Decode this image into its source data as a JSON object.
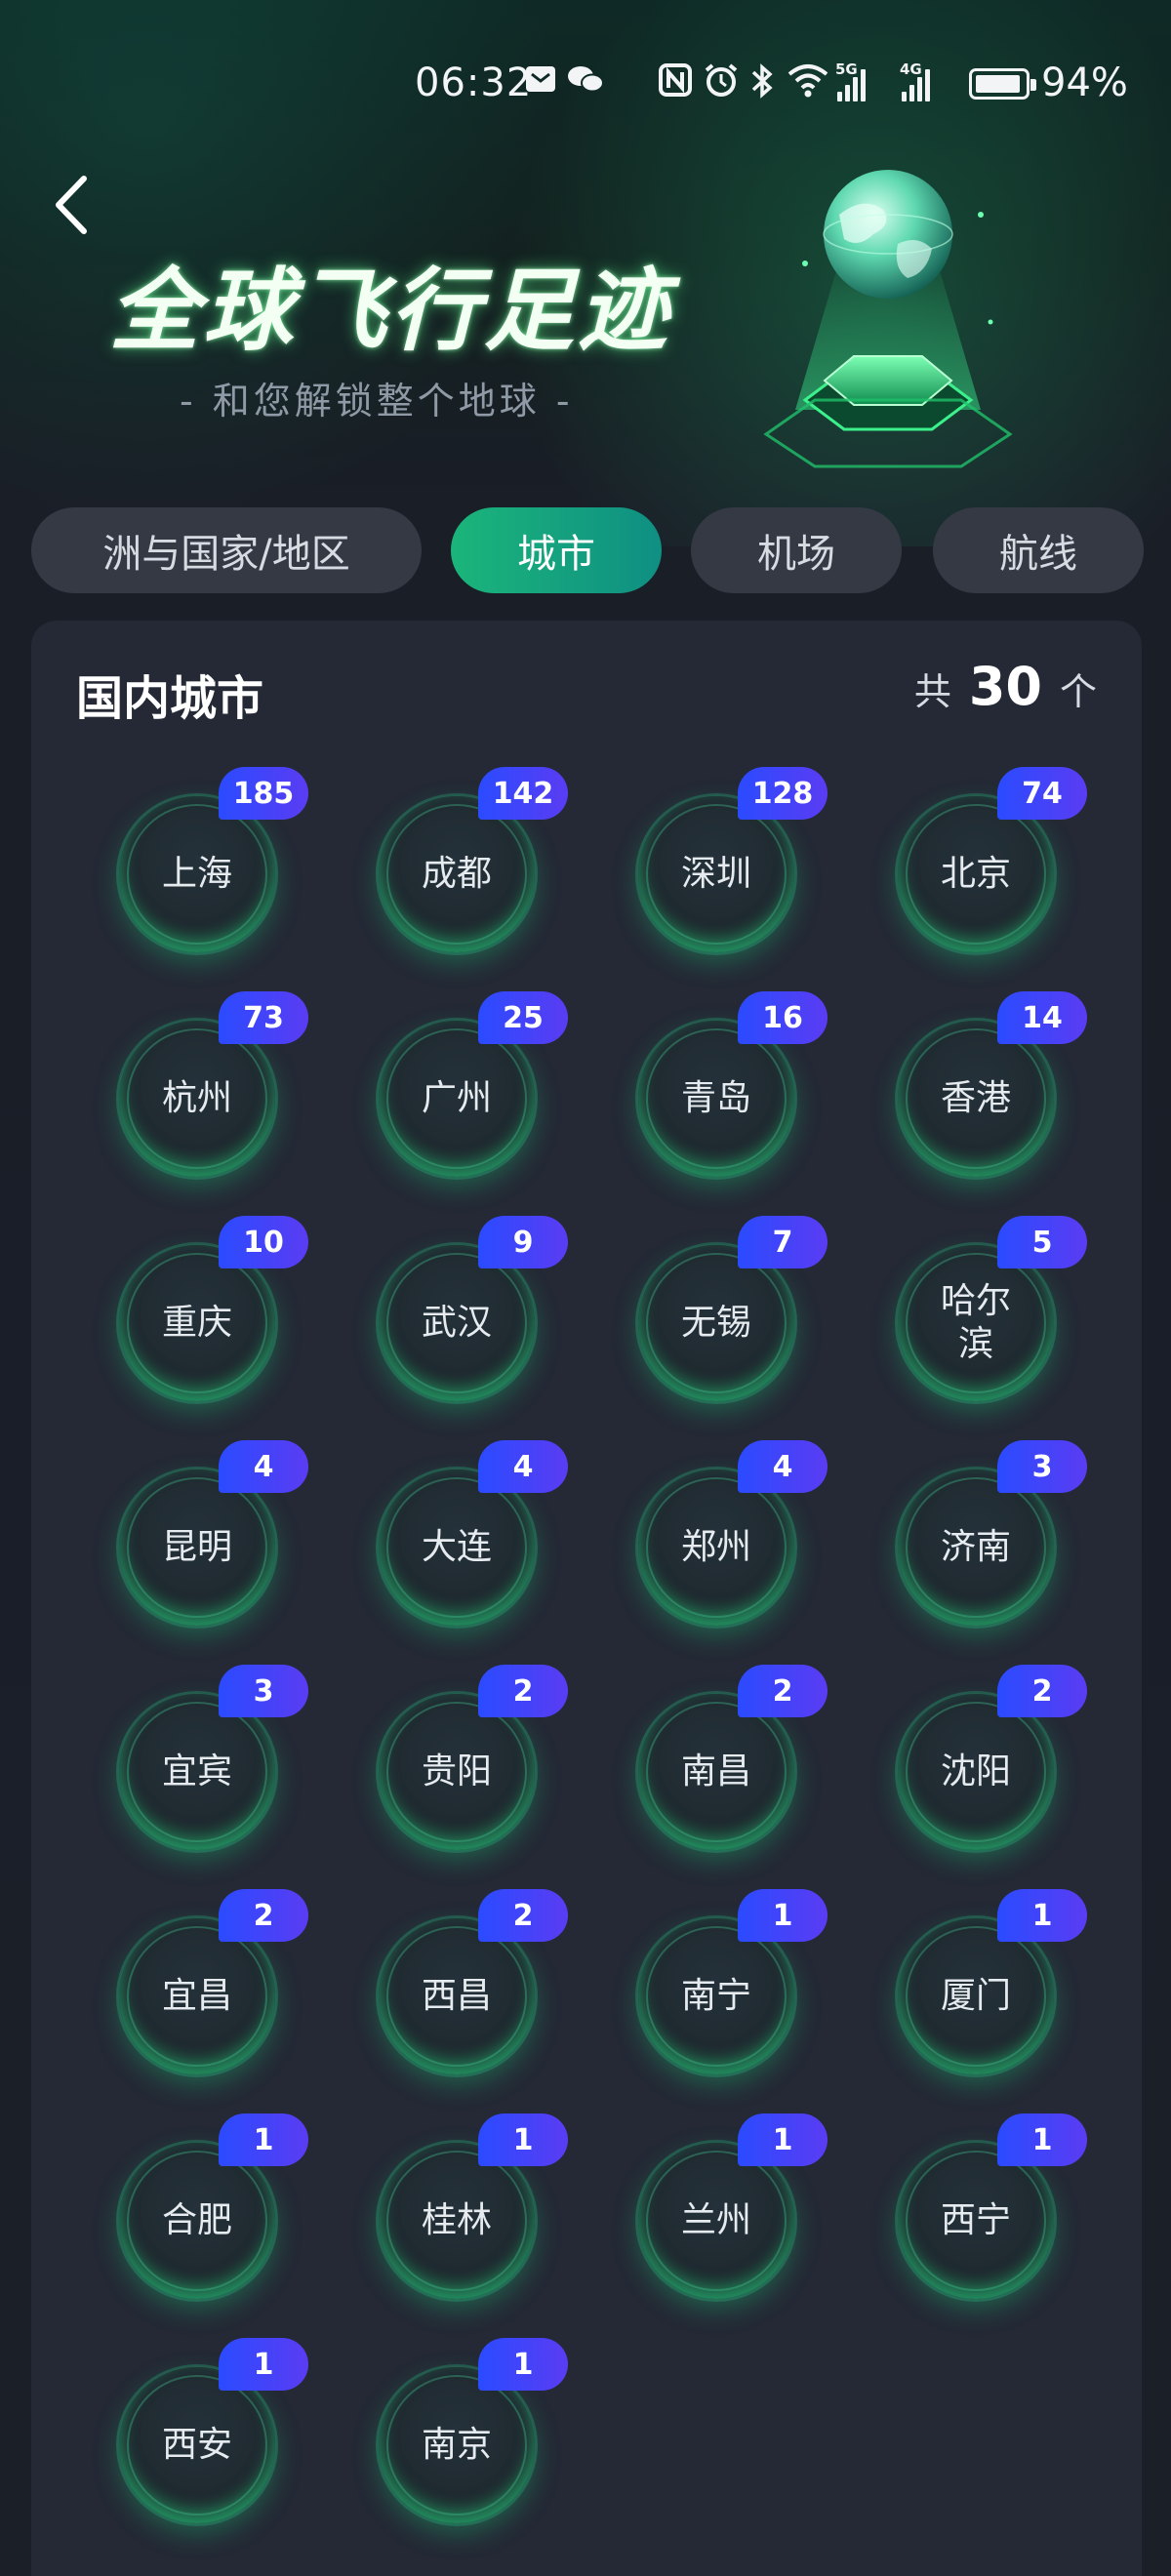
{
  "status_bar": {
    "time": "06:32",
    "battery_percent": "94%",
    "signal_labels": [
      "5G",
      "4G"
    ],
    "icons": [
      "mail-icon",
      "wechat-icon",
      "nfc-icon",
      "alarm-icon",
      "bluetooth-icon",
      "wifi-icon",
      "signal-5g-icon",
      "signal-4g-icon",
      "battery-icon"
    ]
  },
  "header": {
    "title": "全球飞行足迹",
    "subtitle": "- 和您解锁整个地球 -"
  },
  "tabs": [
    {
      "label": "洲与国家/地区",
      "active": false
    },
    {
      "label": "城市",
      "active": true
    },
    {
      "label": "机场",
      "active": false
    },
    {
      "label": "航线",
      "active": false
    }
  ],
  "card": {
    "title": "国内城市",
    "count_prefix": "共",
    "count": "30",
    "count_suffix": "个"
  },
  "cities": [
    {
      "name": "上海",
      "count": "185"
    },
    {
      "name": "成都",
      "count": "142"
    },
    {
      "name": "深圳",
      "count": "128"
    },
    {
      "name": "北京",
      "count": "74"
    },
    {
      "name": "杭州",
      "count": "73"
    },
    {
      "name": "广州",
      "count": "25"
    },
    {
      "name": "青岛",
      "count": "16"
    },
    {
      "name": "香港",
      "count": "14"
    },
    {
      "name": "重庆",
      "count": "10"
    },
    {
      "name": "武汉",
      "count": "9"
    },
    {
      "name": "无锡",
      "count": "7"
    },
    {
      "name": "哈尔滨",
      "count": "5"
    },
    {
      "name": "昆明",
      "count": "4"
    },
    {
      "name": "大连",
      "count": "4"
    },
    {
      "name": "郑州",
      "count": "4"
    },
    {
      "name": "济南",
      "count": "3"
    },
    {
      "name": "宜宾",
      "count": "3"
    },
    {
      "name": "贵阳",
      "count": "2"
    },
    {
      "name": "南昌",
      "count": "2"
    },
    {
      "name": "沈阳",
      "count": "2"
    },
    {
      "name": "宜昌",
      "count": "2"
    },
    {
      "name": "西昌",
      "count": "2"
    },
    {
      "name": "南宁",
      "count": "1"
    },
    {
      "name": "厦门",
      "count": "1"
    },
    {
      "name": "合肥",
      "count": "1"
    },
    {
      "name": "桂林",
      "count": "1"
    },
    {
      "name": "兰州",
      "count": "1"
    },
    {
      "name": "西宁",
      "count": "1"
    },
    {
      "name": "西安",
      "count": "1"
    },
    {
      "name": "南京",
      "count": "1"
    }
  ],
  "colors": {
    "accent_green": "#1bb57a",
    "badge_blue": "#2b4bff",
    "badge_purple": "#5a3cf3",
    "card_bg": "#242935",
    "tab_bg": "#343944"
  }
}
